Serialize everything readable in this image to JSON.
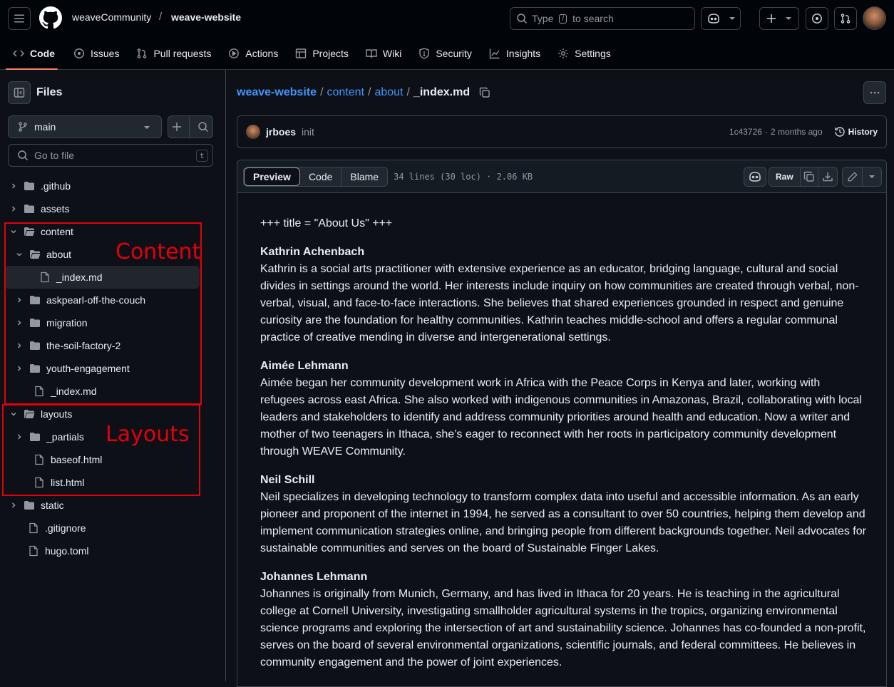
{
  "header": {
    "owner": "weaveCommunity",
    "separator": "/",
    "repo": "weave-website",
    "search_type": "Type",
    "search_key": "/",
    "search_suffix": "to search"
  },
  "nav": {
    "items": [
      {
        "label": "Code",
        "icon": "code-icon"
      },
      {
        "label": "Issues",
        "icon": "issue-icon"
      },
      {
        "label": "Pull requests",
        "icon": "pull-request-icon"
      },
      {
        "label": "Actions",
        "icon": "play-icon"
      },
      {
        "label": "Projects",
        "icon": "table-icon"
      },
      {
        "label": "Wiki",
        "icon": "book-icon"
      },
      {
        "label": "Security",
        "icon": "shield-icon"
      },
      {
        "label": "Insights",
        "icon": "graph-icon"
      },
      {
        "label": "Settings",
        "icon": "gear-icon"
      }
    ]
  },
  "sidebar": {
    "title": "Files",
    "branch": "main",
    "goto_placeholder": "Go to file",
    "goto_key": "t",
    "tree": [
      {
        "label": ".github",
        "type": "folder",
        "state": "collapsed"
      },
      {
        "label": "assets",
        "type": "folder",
        "state": "collapsed"
      },
      {
        "label": "content",
        "type": "folder",
        "state": "expanded"
      },
      {
        "label": "about",
        "type": "folder",
        "state": "expanded"
      },
      {
        "label": "_index.md",
        "type": "file",
        "selected": true
      },
      {
        "label": "askpearl-off-the-couch",
        "type": "folder",
        "state": "collapsed"
      },
      {
        "label": "migration",
        "type": "folder",
        "state": "collapsed"
      },
      {
        "label": "the-soil-factory-2",
        "type": "folder",
        "state": "collapsed"
      },
      {
        "label": "youth-engagement",
        "type": "folder",
        "state": "collapsed"
      },
      {
        "label": "_index.md",
        "type": "file"
      },
      {
        "label": "layouts",
        "type": "folder",
        "state": "expanded"
      },
      {
        "label": "_partials",
        "type": "folder",
        "state": "collapsed"
      },
      {
        "label": "baseof.html",
        "type": "file"
      },
      {
        "label": "list.html",
        "type": "file"
      },
      {
        "label": "static",
        "type": "folder",
        "state": "collapsed"
      },
      {
        "label": ".gitignore",
        "type": "file"
      },
      {
        "label": "hugo.toml",
        "type": "file"
      }
    ]
  },
  "annotations": {
    "content_label": "Content",
    "layouts_label": "Layouts",
    "color": "#e3000b"
  },
  "main": {
    "breadcrumb": {
      "repo": "weave-website",
      "sep": "/",
      "p1": "content",
      "p2": "about",
      "file": "_index.md"
    },
    "commit": {
      "author": "jrboes",
      "message": "init",
      "hash": "1c43726",
      "dot": "·",
      "time": "2 months ago",
      "history": "History"
    },
    "file": {
      "tabs": [
        "Preview",
        "Code",
        "Blame"
      ],
      "meta": "34 lines (30 loc) · 2.06 KB",
      "raw": "Raw"
    },
    "body": {
      "front": "+++ title = \"About Us\" +++",
      "people": [
        {
          "name": "Kathrin Achenbach",
          "bio": "Kathrin is a social arts practitioner with extensive experience as an educator, bridging language, cultural and social divides in settings around the world. Her interests include inquiry on how communities are created through verbal, non-verbal, visual, and face-to-face interactions. She believes that shared experiences grounded in respect and genuine curiosity are the foundation for healthy communities. Kathrin teaches middle-school and offers a regular communal practice of creative mending in diverse and intergenerational settings."
        },
        {
          "name": "Aimée Lehmann",
          "bio": "Aimée began her community development work in Africa with the Peace Corps in Kenya and later, working with refugees across east Africa. She also worked with indigenous communities in Amazonas, Brazil, collaborating with local leaders and stakeholders to identify and address community priorities around health and education. Now a writer and mother of two teenagers in Ithaca, she’s eager to reconnect with her roots in participatory community development through WEAVE Community."
        },
        {
          "name": "Neil Schill",
          "bio": "Neil specializes in developing technology to transform complex data into useful and accessible information. As an early pioneer and proponent of the internet in 1994, he served as a consultant to over 50 countries, helping them develop and implement communication strategies online, and bringing people from different backgrounds together. Neil advocates for sustainable communities and serves on the board of Sustainable Finger Lakes."
        },
        {
          "name": "Johannes Lehmann",
          "bio": "Johannes is originally from Munich, Germany, and has lived in Ithaca for 20 years. He is teaching in the agricultural college at Cornell University, investigating smallholder agricultural systems in the tropics, organizing environmental science programs and exploring the intersection of art and sustainability science. Johannes has co-founded a non-profit, serves on the board of several environmental organizations, scientific journals, and federal committees. He believes in community engagement and the power of joint experiences."
        }
      ]
    }
  }
}
